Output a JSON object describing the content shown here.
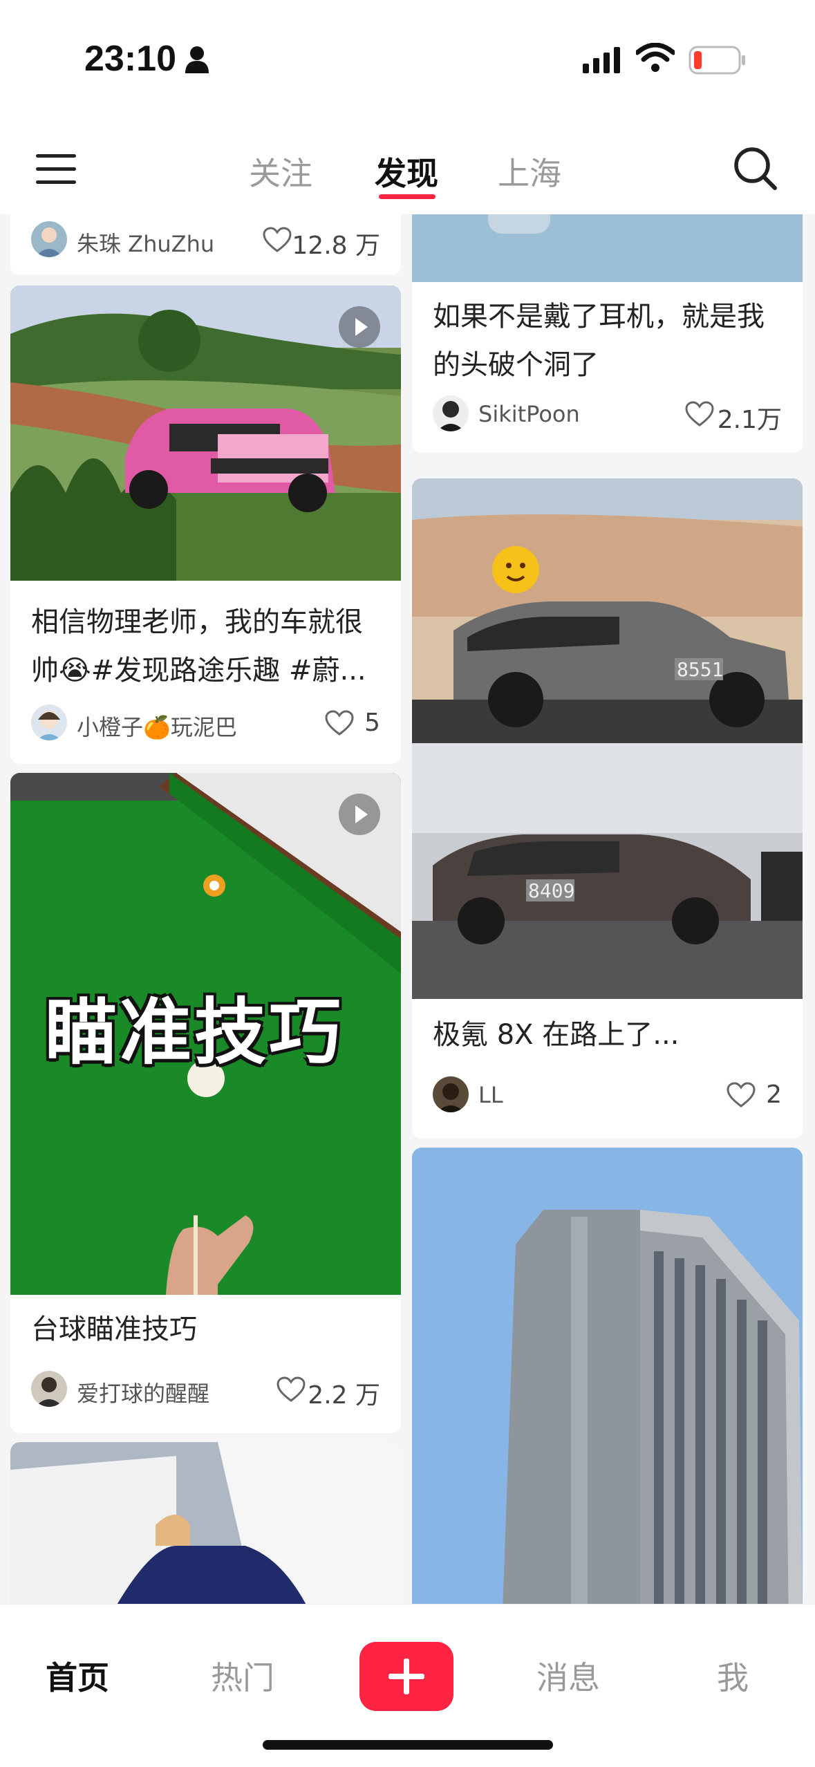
{
  "status_bar": {
    "time": "23:10",
    "icons": [
      "person-icon",
      "cellular-signal-icon",
      "wifi-icon",
      "battery-low-icon"
    ],
    "battery_color": "#ff3b30"
  },
  "top_nav": {
    "menu_icon": "hamburger-menu-icon",
    "tabs": [
      {
        "label": "关注",
        "active": false
      },
      {
        "label": "发现",
        "active": true
      },
      {
        "label": "上海",
        "active": false
      }
    ],
    "search_icon": "search-icon",
    "accent_color": "#ff2442"
  },
  "feed": {
    "left_column": [
      {
        "author": "朱珠 ZhuZhu",
        "likes": "12.8 万"
      },
      {
        "title": "相信物理老师，我的车就很帅😭#发现路途乐趣 #蔚...",
        "author": "小橙子🍊玩泥巴",
        "likes": "5",
        "is_video": true
      },
      {
        "overlay_text": "瞄准技巧",
        "title": "台球瞄准技巧",
        "author": "爱打球的醒醒",
        "likes": "2.2 万",
        "is_video": true
      },
      {}
    ],
    "right_column": [
      {
        "title": "如果不是戴了耳机，就是我的头破个洞了",
        "author": "SikitPoon",
        "likes": "2.1万"
      },
      {
        "plates": [
          "8551",
          "8409"
        ],
        "title": "极氪 8X 在路上了...",
        "author": "LL",
        "likes": "2"
      },
      {}
    ]
  },
  "bottom_nav": {
    "items": [
      {
        "label": "首页",
        "active": true
      },
      {
        "label": "热门",
        "active": false
      },
      {
        "label": "消息",
        "active": false
      },
      {
        "label": "我",
        "active": false
      }
    ],
    "post_icon": "plus-icon"
  }
}
